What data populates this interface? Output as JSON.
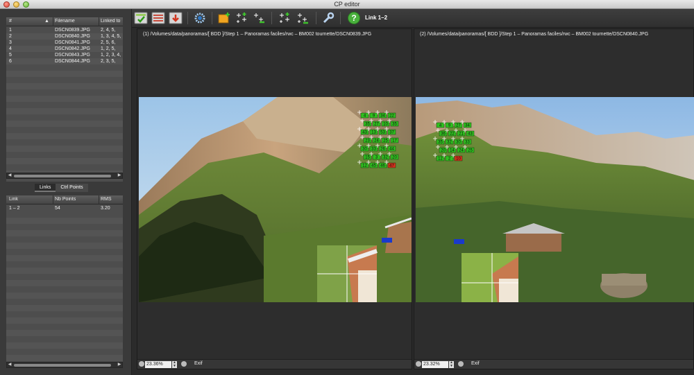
{
  "window": {
    "title": "CP editor"
  },
  "images_table": {
    "headers": [
      "#",
      "Filename",
      "Linked to"
    ],
    "rows": [
      {
        "num": "1",
        "filename": "DSCN0839.JPG",
        "linked": "2, 4, 5,"
      },
      {
        "num": "2",
        "filename": "DSCN0840.JPG",
        "linked": "1, 3, 4, 5,"
      },
      {
        "num": "3",
        "filename": "DSCN0841.JPG",
        "linked": "2, 5, 6,"
      },
      {
        "num": "4",
        "filename": "DSCN0842.JPG",
        "linked": "1, 2, 5,"
      },
      {
        "num": "5",
        "filename": "DSCN0843.JPG",
        "linked": "1, 2, 3, 4,"
      },
      {
        "num": "6",
        "filename": "DSCN0844.JPG",
        "linked": "2, 3, 5,"
      }
    ]
  },
  "tabs": [
    {
      "label": "Links",
      "active": true
    },
    {
      "label": "Ctrl Points",
      "active": false
    }
  ],
  "links_table": {
    "headers": [
      "Link",
      "Nb Points",
      "RMS"
    ],
    "rows": [
      {
        "link": "1 – 2",
        "points": "54",
        "rms": "3.20"
      }
    ]
  },
  "toolbar": {
    "link_label": "Link 1–2",
    "icons": [
      "save-green-icon",
      "list-icon",
      "export-red-icon",
      "gear-icon",
      "add-point-icon",
      "add-grid-icon",
      "remove-point-icon",
      "add-grid-alt-icon",
      "remove-grid-icon",
      "wrench-icon",
      "help-icon"
    ]
  },
  "left_image": {
    "path": "(1) /Volumes/data/panoramas/[ BDD ]/Step 1 – Panoramas faciles/rwc – BM002 tournette/DSCN0839.JPG",
    "zoom": "23.36%",
    "exif_label": "Exif"
  },
  "right_image": {
    "path": "(2) /Volumes/data/panoramas/[ BDD ]/Step 1 – Panoramas faciles/rwc – BM002 tournette/DSCN0840.JPG",
    "zoom": "23.32%",
    "exif_label": "Exif"
  },
  "control_points_left": [
    "4",
    "9",
    "34",
    "22",
    "35",
    "27",
    "10",
    "35",
    "43",
    "13",
    "53",
    "37",
    "23",
    "24",
    "25",
    "17",
    "30",
    "33",
    "26",
    "44",
    "15",
    "3",
    "32",
    "20",
    "12",
    "45",
    "46",
    "47"
  ],
  "control_points_right": [
    "4",
    "9",
    "27",
    "34",
    "36",
    "22",
    "21",
    "43",
    "35",
    "32",
    "30",
    "33",
    "20",
    "14",
    "24",
    "25",
    "12",
    "2",
    "10"
  ],
  "colors": {
    "cp_green": "#2fbf1f",
    "cp_red": "#d6301b",
    "sky": "#9fc3e3"
  }
}
